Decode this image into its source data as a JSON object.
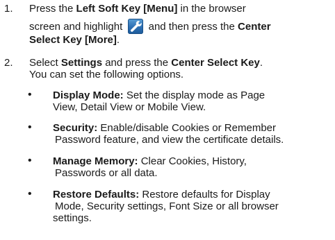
{
  "step1": {
    "number": "1.",
    "line1_pre": "Press the ",
    "line1_bold": "Left Soft Key [Menu]",
    "line1_post": " in the browser",
    "line2_pre": "screen and highlight ",
    "line2_mid": " and then press the ",
    "line2_bold": "Center",
    "line3_bold": "Select Key [More]",
    "line3_post": ".",
    "icon": "wrench-tool-icon"
  },
  "step2": {
    "number": "2.",
    "line1_pre": "Select ",
    "line1_bold1": "Settings",
    "line1_mid": " and press the ",
    "line1_bold2": "Center Select Key",
    "line1_post": ".",
    "line2": "You can set the following options."
  },
  "bullets": [
    {
      "term": "Display Mode:",
      "line1": " Set the display mode as Page",
      "line2": "View, Detail View or Mobile View."
    },
    {
      "term": "Security:",
      "line1": " Enable/disable Cookies or Remember",
      "line2": "Password feature, and view the certificate details."
    },
    {
      "term": "Manage Memory:",
      "line1": " Clear Cookies, History,",
      "line2": "Passwords or all data."
    },
    {
      "term": "Restore Defaults:",
      "line1": " Restore defaults for Display",
      "line2": "Mode, Security settings, Font Size or all browser",
      "line3": "settings."
    }
  ],
  "bullet_symbol": "•"
}
